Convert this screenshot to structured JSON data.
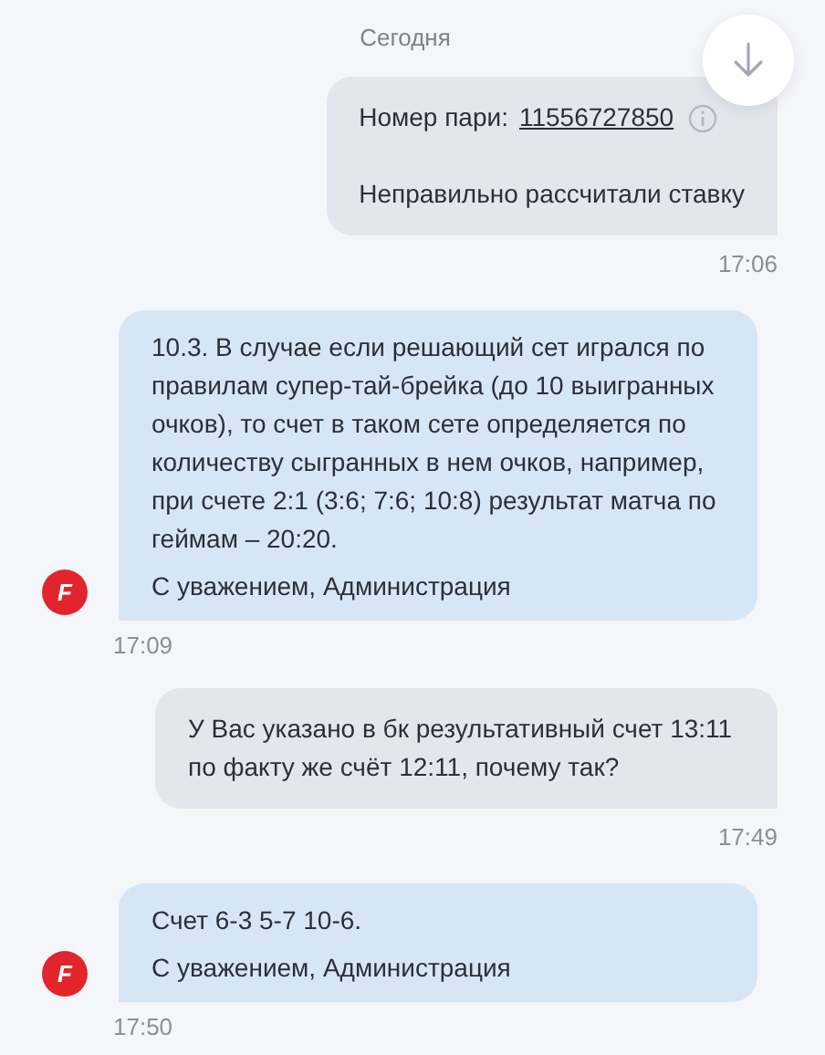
{
  "date_divider": "Сегодня",
  "messages": [
    {
      "kind": "outgoing",
      "bet_label": "Номер пари:",
      "bet_number": "11556727850",
      "paragraphs": [
        "Неправильно рассчитали ставку"
      ],
      "time": "17:06"
    },
    {
      "kind": "incoming",
      "avatar_letter": "F",
      "paragraphs": [
        "10.3. В случае если решающий сет игрался по правилам супер-тай-брейка (до 10 выигранных очков), то счет в таком сете определяется по количеству сыгранных в нем очков, например, при счете 2:1 (3:6; 7:6; 10:8) результат матча по геймам – 20:20.",
        "С уважением, Администрация"
      ],
      "time": "17:09"
    },
    {
      "kind": "outgoing",
      "paragraphs": [
        "У Вас указано в бк результативный счет 13:11 по факту же счёт 12:11, почему так?"
      ],
      "time": "17:49"
    },
    {
      "kind": "incoming",
      "avatar_letter": "F",
      "paragraphs": [
        "Счет 6-3 5-7 10-6.",
        "С уважением, Администрация"
      ],
      "time": "17:50"
    }
  ]
}
